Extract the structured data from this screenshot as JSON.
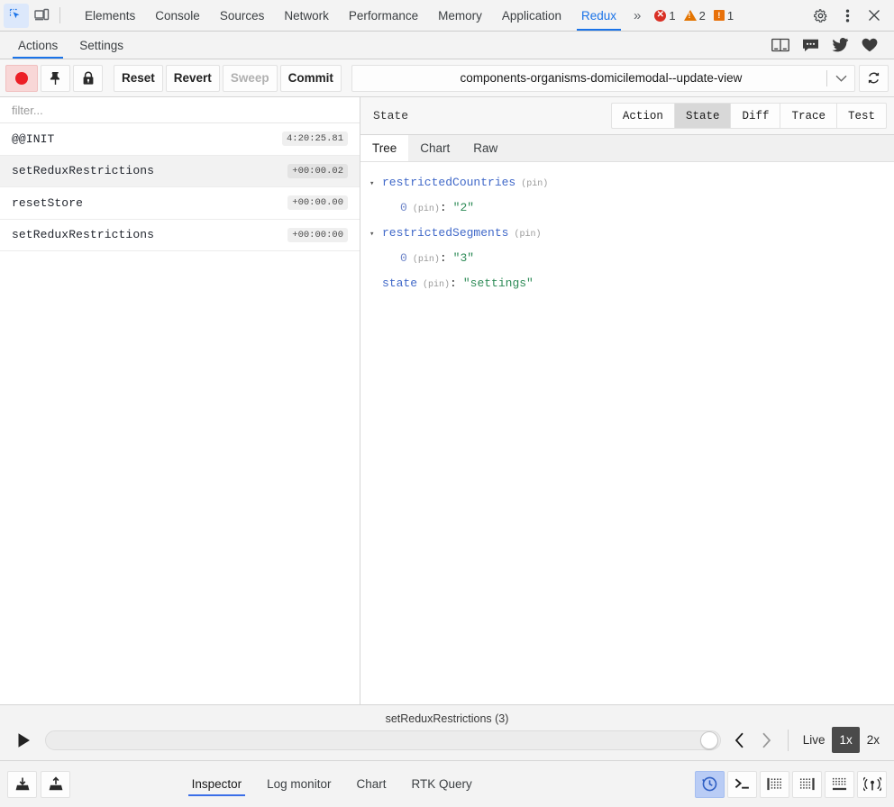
{
  "devtools": {
    "icons": [
      {
        "name": "inspect-element-icon",
        "active": true
      },
      {
        "name": "device-toolbar-icon",
        "active": false
      }
    ],
    "tabs": [
      {
        "label": "Elements",
        "selected": false
      },
      {
        "label": "Console",
        "selected": false
      },
      {
        "label": "Sources",
        "selected": false
      },
      {
        "label": "Network",
        "selected": false
      },
      {
        "label": "Performance",
        "selected": false
      },
      {
        "label": "Memory",
        "selected": false
      },
      {
        "label": "Application",
        "selected": false
      },
      {
        "label": "Redux",
        "selected": true
      }
    ],
    "more_label": "»",
    "counters": {
      "errors": "1",
      "warnings": "2",
      "issues": "1"
    },
    "right_icons": [
      "settings-gear-icon",
      "more-vertical-icon",
      "close-icon"
    ]
  },
  "redux_tabs": {
    "items": [
      {
        "label": "Actions",
        "selected": true
      },
      {
        "label": "Settings",
        "selected": false
      }
    ],
    "right_icons": [
      "book-icon",
      "chat-bubble-icon",
      "twitter-icon",
      "heart-icon"
    ]
  },
  "toolbar": {
    "record_icon": "record-circle-icon",
    "pin_icon": "pin-icon",
    "lock_icon": "lock-icon",
    "reset_label": "Reset",
    "revert_label": "Revert",
    "sweep_label": "Sweep",
    "commit_label": "Commit",
    "instance_selected": "components-organisms-domicilemodal--update-view",
    "dropdown_icon": "chevron-down-icon",
    "refresh_icon": "refresh-icon"
  },
  "actions_pane": {
    "filter_placeholder": "filter...",
    "filter_value": "",
    "rows": [
      {
        "name": "@@INIT",
        "time": "4:20:25.81",
        "selected": false
      },
      {
        "name": "setReduxRestrictions",
        "time": "+00:00.02",
        "selected": true
      },
      {
        "name": "resetStore",
        "time": "+00:00.00",
        "selected": false
      },
      {
        "name": "setReduxRestrictions",
        "time": "+00:00:00",
        "selected": false
      }
    ]
  },
  "state_pane": {
    "title": "State",
    "segments": [
      {
        "label": "Action",
        "selected": false
      },
      {
        "label": "State",
        "selected": true
      },
      {
        "label": "Diff",
        "selected": false
      },
      {
        "label": "Trace",
        "selected": false
      },
      {
        "label": "Test",
        "selected": false
      }
    ],
    "subtabs": [
      {
        "label": "Tree",
        "selected": true
      },
      {
        "label": "Chart",
        "selected": false
      },
      {
        "label": "Raw",
        "selected": false
      }
    ],
    "pin_label": "(pin)",
    "tree": [
      {
        "depth": 0,
        "caret": "▾",
        "key": "restrictedCountries",
        "pin": "(pin)",
        "colon": "",
        "value": ""
      },
      {
        "depth": 1,
        "caret": "",
        "key": "0",
        "pin": "(pin)",
        "colon": ":",
        "value": "\"2\""
      },
      {
        "depth": 0,
        "caret": "▾",
        "key": "restrictedSegments",
        "pin": "(pin)",
        "colon": "",
        "value": ""
      },
      {
        "depth": 1,
        "caret": "",
        "key": "0",
        "pin": "(pin)",
        "colon": ":",
        "value": "\"3\""
      },
      {
        "depth": 0,
        "caret": "",
        "key": "state",
        "pin": "(pin)",
        "colon": ":",
        "value": "\"settings\""
      }
    ]
  },
  "slider": {
    "label": "setReduxRestrictions (3)",
    "play_icon": "play-icon",
    "position_percent": 100,
    "prev_icon": "chevron-left-icon",
    "next_icon": "chevron-right-icon",
    "speeds": [
      {
        "label": "Live",
        "selected": false
      },
      {
        "label": "1x",
        "selected": true
      },
      {
        "label": "2x",
        "selected": false
      }
    ]
  },
  "bottom_bar": {
    "left_icons": [
      "import-icon",
      "export-icon"
    ],
    "tabs": [
      {
        "label": "Inspector",
        "selected": true
      },
      {
        "label": "Log monitor",
        "selected": false
      },
      {
        "label": "Chart",
        "selected": false
      },
      {
        "label": "RTK Query",
        "selected": false
      }
    ],
    "right_icons": [
      {
        "name": "time-travel-icon",
        "active": true
      },
      {
        "name": "terminal-icon",
        "active": false
      },
      {
        "name": "dock-left-icon",
        "active": false
      },
      {
        "name": "dock-right-icon",
        "active": false
      },
      {
        "name": "dock-bottom-icon",
        "active": false
      },
      {
        "name": "broadcast-icon",
        "active": false
      }
    ]
  },
  "colors": {
    "accent": "#1a73e8",
    "record_red": "#ec1f26",
    "error_red": "#d93025",
    "warning_orange": "#e37400",
    "key_blue": "#4169c9",
    "string_green": "#2e8b57",
    "active_blue_bg": "#b9ccf5"
  }
}
